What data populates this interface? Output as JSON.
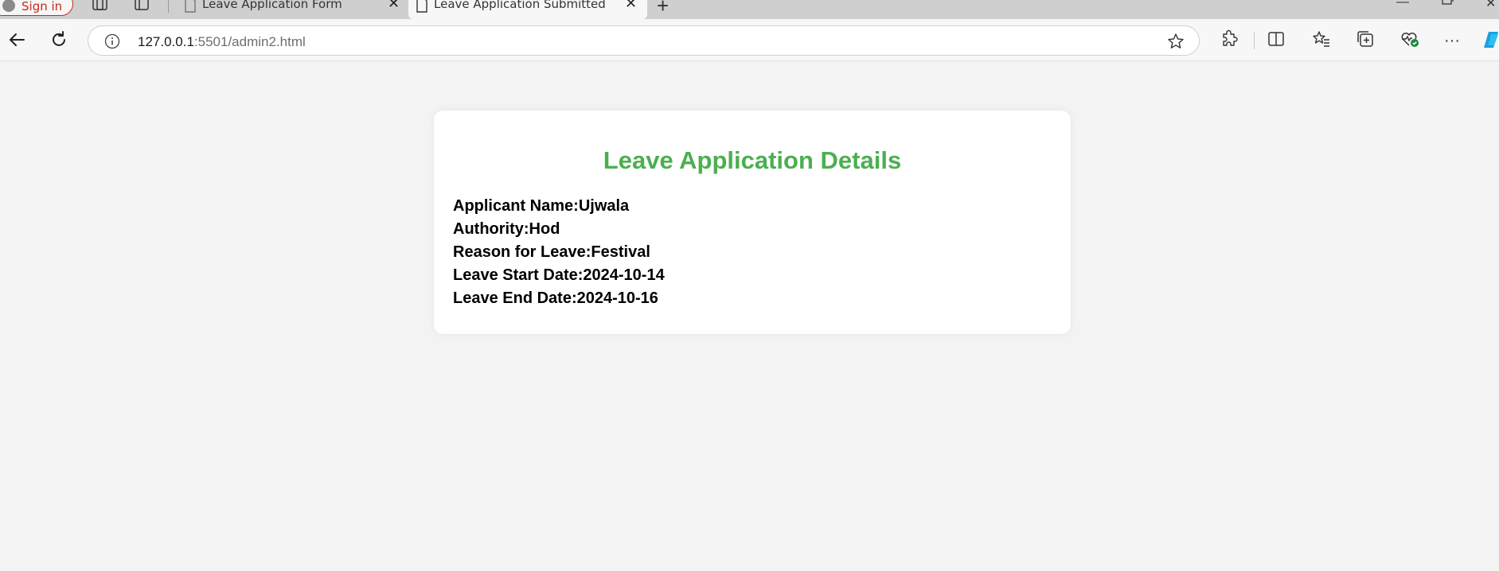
{
  "browser": {
    "profile_label": "Sign in",
    "tabs": [
      {
        "title": "Leave Application Form",
        "active": false
      },
      {
        "title": "Leave Application Submitted",
        "active": true
      }
    ],
    "address_bar": {
      "host": "127.0.0.1",
      "path": ":5501/admin2.html"
    },
    "accent_color": "#c42b1c"
  },
  "page": {
    "heading": "Leave Application Details",
    "heading_color": "#4caf50",
    "details": [
      {
        "label": "Applicant Name:",
        "value": "Ujwala"
      },
      {
        "label": "Authority:",
        "value": "Hod"
      },
      {
        "label": "Reason for Leave:",
        "value": "Festival"
      },
      {
        "label": "Leave Start Date:",
        "value": "2024-10-14"
      },
      {
        "label": "Leave End Date:",
        "value": "2024-10-16"
      }
    ]
  }
}
